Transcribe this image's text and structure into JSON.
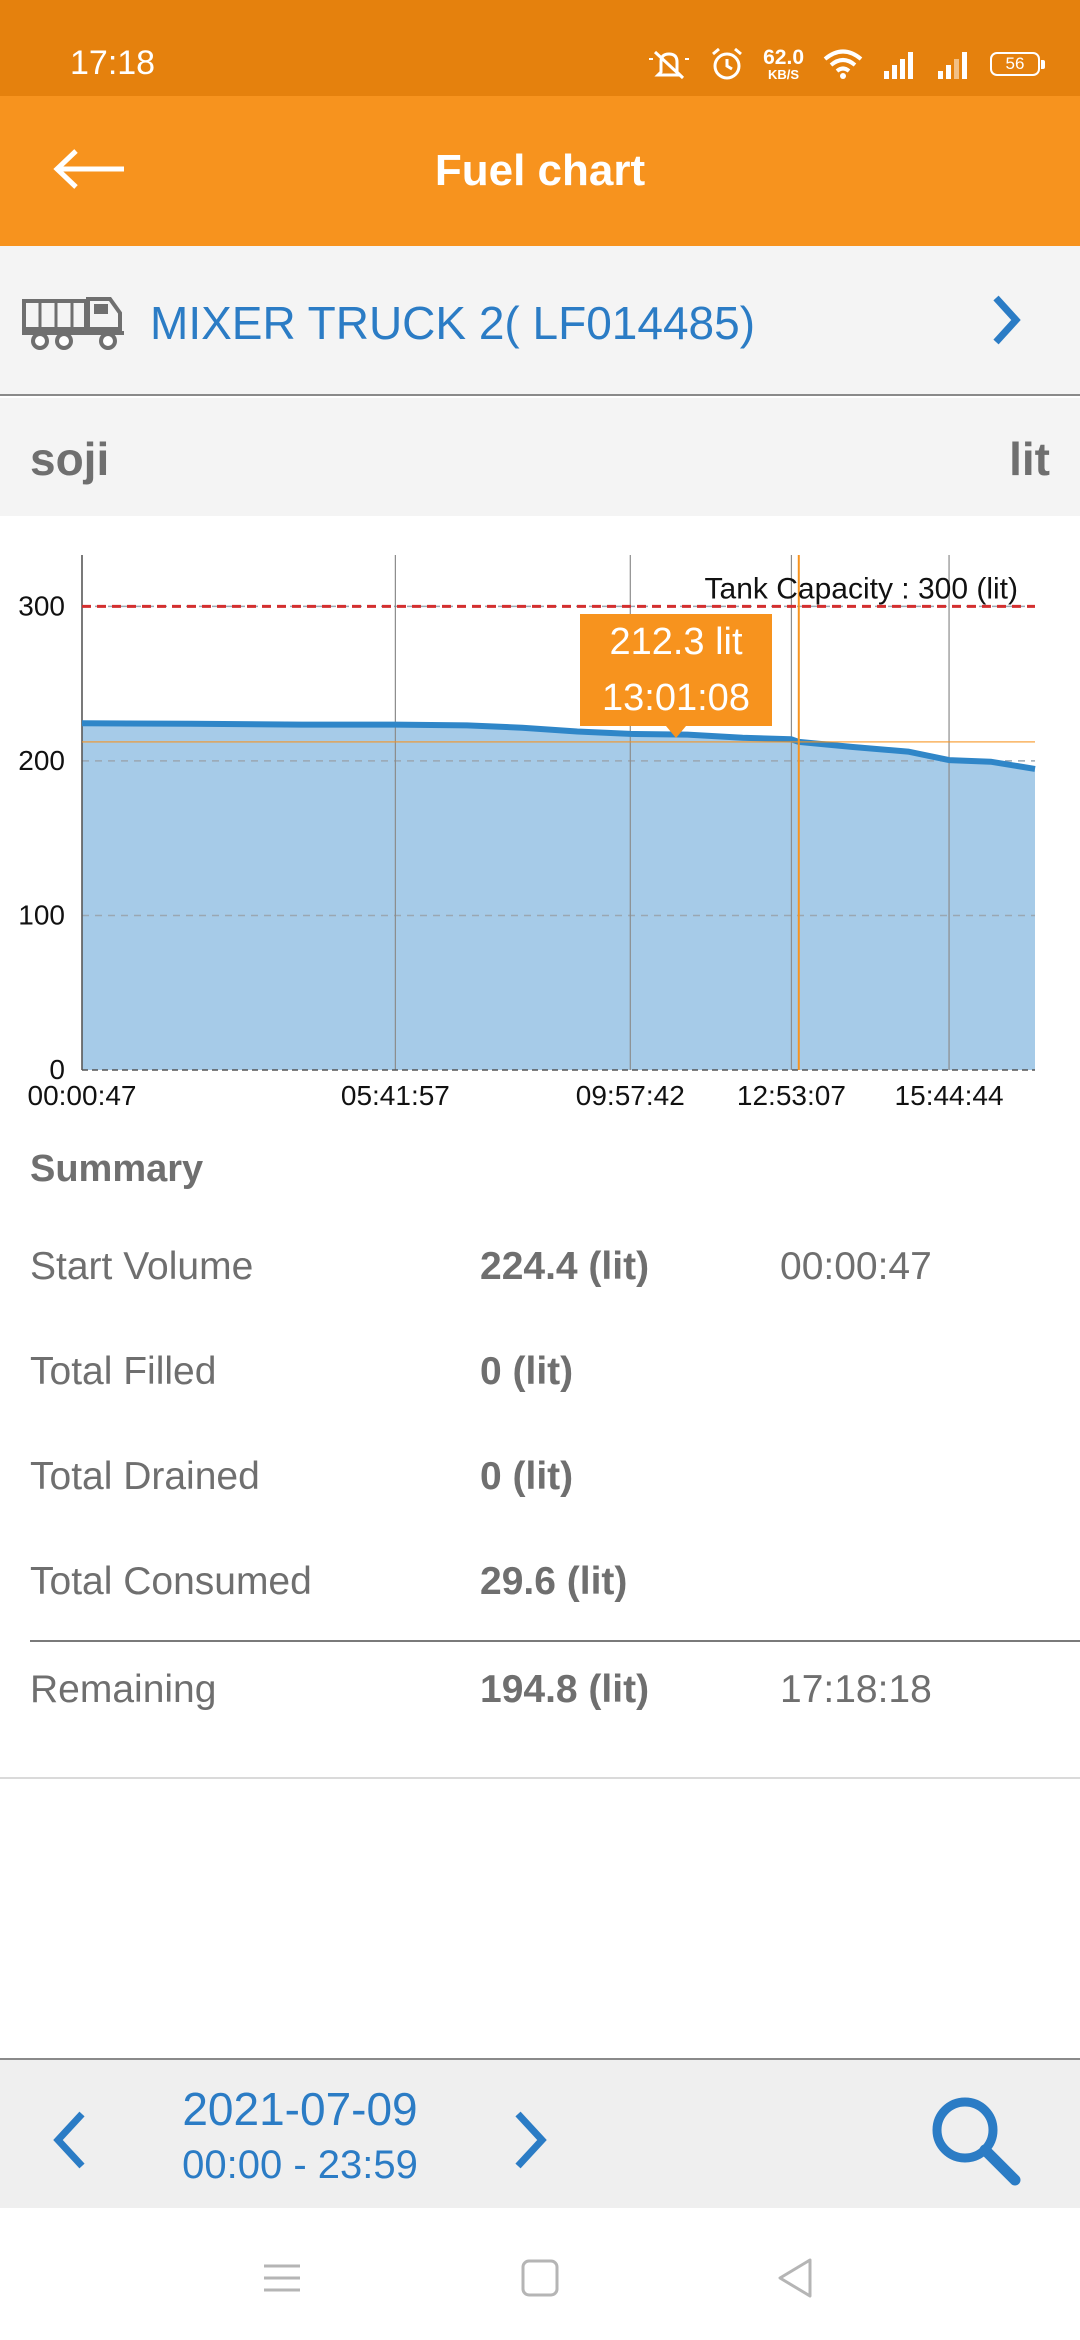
{
  "status_bar": {
    "time": "17:18",
    "net_speed_value": "62.0",
    "net_speed_unit": "KB/S",
    "battery": "56",
    "icons": [
      "mute-icon",
      "alarm-icon",
      "wifi-icon",
      "signal-icon",
      "signal-icon",
      "battery-icon"
    ]
  },
  "app_bar": {
    "title": "Fuel chart",
    "back_icon": "back-arrow-icon"
  },
  "vehicle": {
    "name": "MIXER TRUCK 2( LF014485)",
    "icon": "truck-icon",
    "chevron": "chevron-right-icon"
  },
  "sensor": {
    "name": "soji",
    "unit": "lit"
  },
  "chart_data": {
    "type": "area",
    "x": [
      "00:00:47",
      "02:00:00",
      "04:00:00",
      "05:41:57",
      "07:00:00",
      "08:00:00",
      "09:00:00",
      "09:57:42",
      "11:00:00",
      "12:00:00",
      "12:53:07",
      "13:01:08",
      "14:00:00",
      "15:00:00",
      "15:44:44",
      "16:30:00",
      "17:18:18"
    ],
    "series": [
      {
        "values": [
          224.4,
          224,
          223.5,
          223.5,
          223,
          221.5,
          219,
          217.5,
          217,
          215,
          214,
          212.3,
          209,
          206,
          200.5,
          199.5,
          194.8
        ]
      }
    ],
    "x_tick_labels": [
      "00:00:47",
      "05:41:57",
      "09:57:42",
      "12:53:07",
      "15:44:44"
    ],
    "y_tick_labels": [
      "0",
      "100",
      "200",
      "300"
    ],
    "ylim": [
      0,
      330
    ],
    "reference_line": {
      "label": "Tank Capacity : 300 (lit)",
      "value": 300,
      "color": "#D32F2F"
    },
    "tooltip": {
      "value": "212.3 lit",
      "time": "13:01:08"
    },
    "fill_color": "#A6CBE8",
    "line_color": "#2F86C8",
    "highlight_color": "#F7931E"
  },
  "summary": {
    "title": "Summary",
    "rows": [
      {
        "label": "Start Volume",
        "value": "224.4 (lit)",
        "time": "00:00:47"
      },
      {
        "label": "Total Filled",
        "value": "0 (lit)",
        "time": ""
      },
      {
        "label": "Total Drained",
        "value": "0 (lit)",
        "time": ""
      },
      {
        "label": "Total Consumed",
        "value": "29.6 (lit)",
        "time": ""
      }
    ],
    "remaining": {
      "label": "Remaining",
      "value": "194.8 (lit)",
      "time": "17:18:18"
    }
  },
  "footer": {
    "date": "2021-07-09",
    "range": "00:00 - 23:59",
    "prev_icon": "chevron-left-icon",
    "next_icon": "chevron-right-icon",
    "search_icon": "search-icon"
  },
  "nav": {
    "icons": [
      "menu-icon",
      "home-square-icon",
      "back-triangle-icon"
    ]
  },
  "colors": {
    "status_bar": "#E5810D",
    "app_bar": "#F7931E",
    "accent_blue": "#2B7CC5",
    "text_gray": "#6F6F6F"
  }
}
